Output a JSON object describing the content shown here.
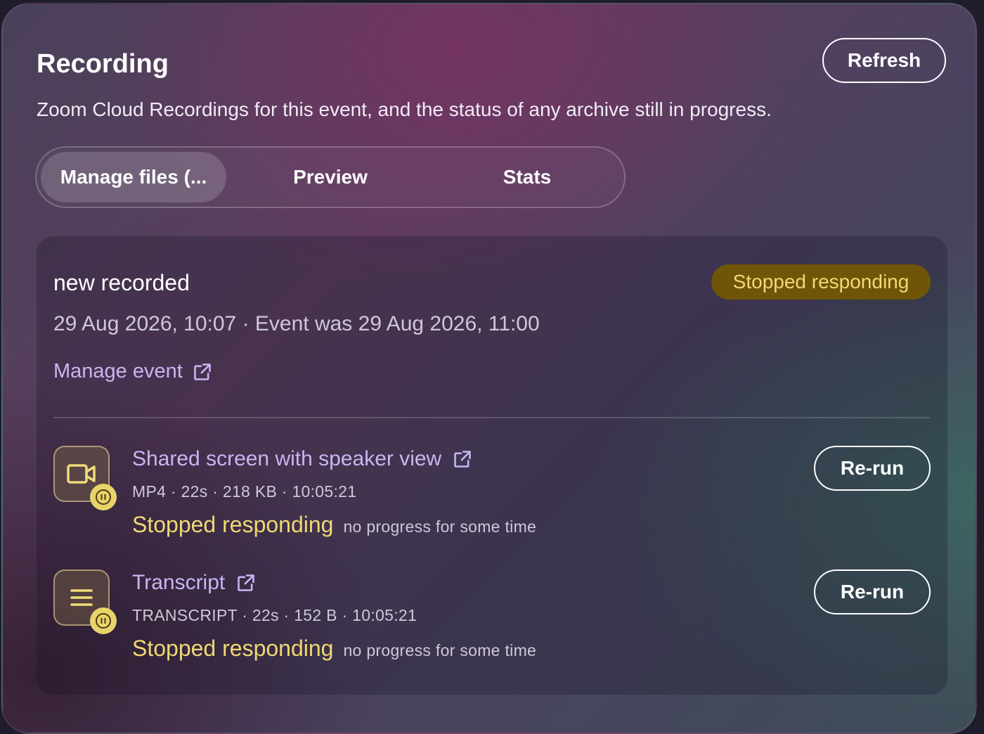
{
  "header": {
    "title": "Recording",
    "subtitle": "Zoom Cloud Recordings for this event, and the status of any archive still in progress.",
    "refresh_label": "Refresh"
  },
  "tabs": [
    {
      "label": "Manage files (...",
      "active": true
    },
    {
      "label": "Preview",
      "active": false
    },
    {
      "label": "Stats",
      "active": false
    }
  ],
  "recording": {
    "name": "new recorded",
    "status": "Stopped responding",
    "meta": "29 Aug 2026, 10:07 · Event was 29 Aug 2026, 11:00",
    "manage_link": "Manage event",
    "files": [
      {
        "icon": "video-camera-icon",
        "name": "Shared screen with speaker view",
        "meta": "MP4 · 22s · 218 KB · 10:05:21",
        "status": "Stopped responding",
        "status_note": "no progress for some time",
        "action": "Re-run"
      },
      {
        "icon": "transcript-lines-icon",
        "name": "Transcript",
        "meta": "TRANSCRIPT · 22s · 152 B · 10:05:21",
        "status": "Stopped responding",
        "status_note": "no progress for some time",
        "action": "Re-run"
      }
    ]
  },
  "colors": {
    "accent_link": "#c9b5f2",
    "warning_text": "#efd873",
    "warning_badge_bg": "#6f5508"
  }
}
